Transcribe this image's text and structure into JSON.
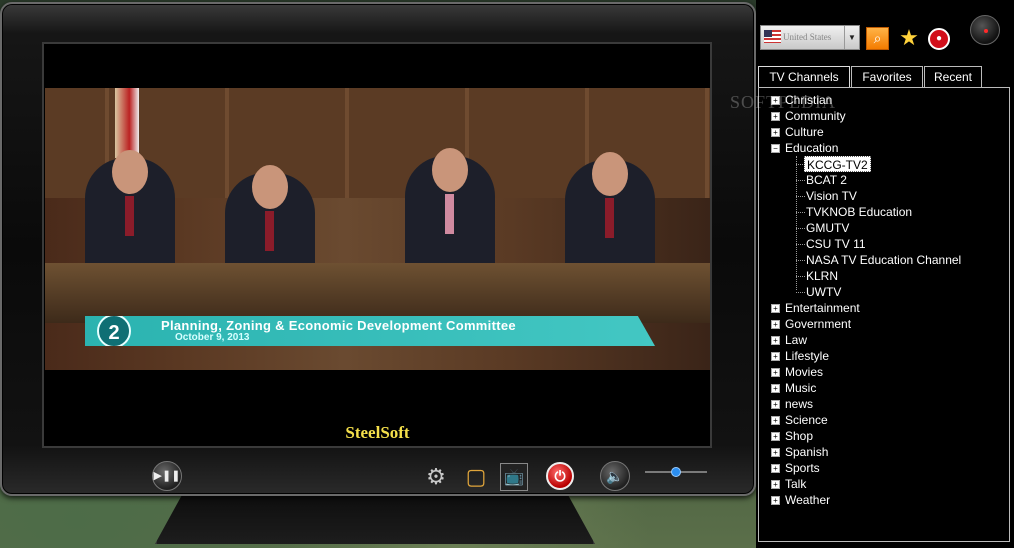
{
  "tv": {
    "brand": "SteelSoft",
    "video": {
      "banner_number": "2",
      "banner_title": "Planning, Zoning & Economic Development Committee",
      "banner_date": "October 9, 2013"
    },
    "controls": {
      "play_pause": "▶❚❚",
      "settings": "⚙",
      "aspect": "▢",
      "record_tv": "📺",
      "stop": "⏻",
      "mute": "🔈",
      "volume": 0.5
    }
  },
  "toolbar": {
    "country": "United States",
    "search_icon": "search-icon",
    "favorite_icon": "star-icon",
    "record_icon": "record-icon",
    "power_icon": "power-icon"
  },
  "watermark": "SOFTPEDIA",
  "tabs": [
    {
      "label": "TV Channels",
      "active": true
    },
    {
      "label": "Favorites",
      "active": false
    },
    {
      "label": "Recent",
      "active": false
    }
  ],
  "categories_top": [
    {
      "label": "Christian",
      "expanded": false
    },
    {
      "label": "Community",
      "expanded": false
    },
    {
      "label": "Culture",
      "expanded": false
    },
    {
      "label": "Education",
      "expanded": true
    }
  ],
  "education_channels": [
    {
      "label": "KCCG-TV2",
      "selected": true
    },
    {
      "label": "BCAT 2",
      "selected": false
    },
    {
      "label": "Vision TV",
      "selected": false
    },
    {
      "label": "TVKNOB Education",
      "selected": false
    },
    {
      "label": "GMUTV",
      "selected": false
    },
    {
      "label": "CSU TV 11",
      "selected": false
    },
    {
      "label": "NASA TV Education Channel",
      "selected": false
    },
    {
      "label": "KLRN",
      "selected": false
    },
    {
      "label": "UWTV",
      "selected": false
    }
  ],
  "categories_bottom": [
    {
      "label": "Entertainment"
    },
    {
      "label": "Government"
    },
    {
      "label": "Law"
    },
    {
      "label": "Lifestyle"
    },
    {
      "label": "Movies"
    },
    {
      "label": "Music"
    },
    {
      "label": "news"
    },
    {
      "label": "Science"
    },
    {
      "label": "Shop"
    },
    {
      "label": "Spanish"
    },
    {
      "label": "Sports"
    },
    {
      "label": "Talk"
    },
    {
      "label": "Weather"
    }
  ]
}
